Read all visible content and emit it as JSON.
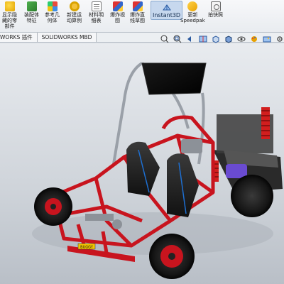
{
  "ribbon": {
    "buttons": [
      {
        "label": "显示隐\n藏的零\n部件",
        "icon": "show-hidden-components-icon"
      },
      {
        "label": "装配体\n特征",
        "icon": "assembly-features-icon"
      },
      {
        "label": "参考几\n何体",
        "icon": "reference-geometry-icon"
      },
      {
        "label": "新建运\n动算例",
        "icon": "new-motion-study-icon"
      },
      {
        "label": "材料明\n细表",
        "icon": "bill-of-materials-icon"
      },
      {
        "label": "爆炸视\n图",
        "icon": "exploded-view-icon"
      },
      {
        "label": "爆炸直\n线草图",
        "icon": "explode-line-sketch-icon"
      },
      {
        "label": "Instant3D",
        "icon": "instant3d-icon"
      },
      {
        "label": "更新\nSpeedpak",
        "icon": "speedpak-icon"
      },
      {
        "label": "拍快照",
        "icon": "snapshot-icon"
      }
    ]
  },
  "tabs": [
    "WORKS 插件",
    "SOLIDWORKS MBD"
  ],
  "hud_icons": [
    "zoom-to-fit-icon",
    "zoom-area-icon",
    "previous-view-icon",
    "section-view-icon",
    "view-orientation-icon",
    "display-style-icon",
    "hide-show-items-icon",
    "edit-appearance-icon",
    "apply-scene-icon",
    "view-settings-icon",
    "monitor-icon"
  ],
  "viewport": {
    "model_name": "buggy-assembly",
    "plate_text": "BUGGY"
  },
  "colors": {
    "frame_red": "#c8141e",
    "roof_black": "#0c0c0c",
    "seat_blue_trim": "#1e6fd1",
    "spring_red": "#d21e1e",
    "purple_part": "#6a4bd1"
  }
}
